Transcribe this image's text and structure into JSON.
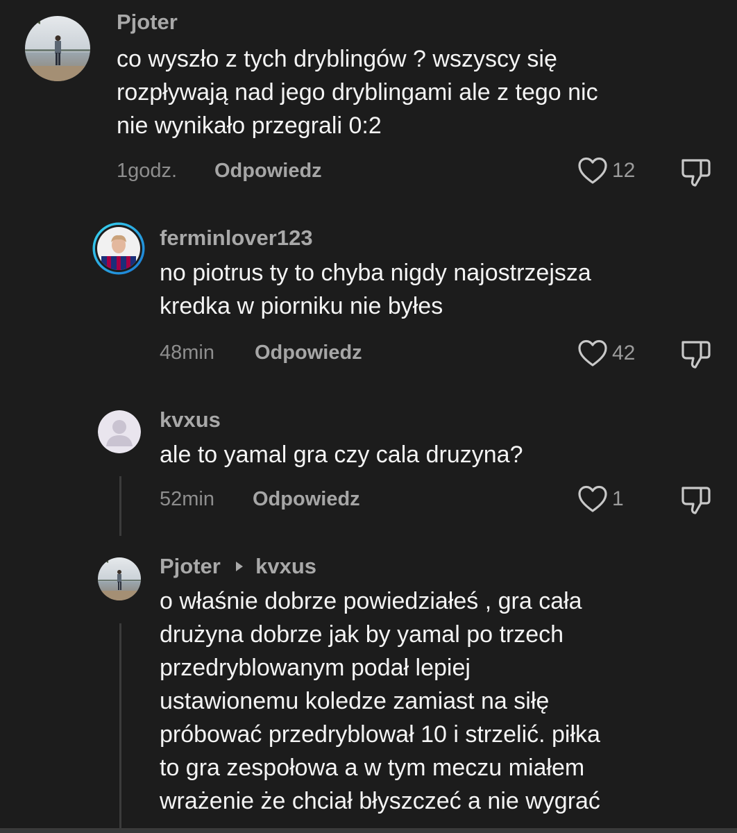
{
  "colors": {
    "background": "#1c1c1c",
    "username": "#a9a9a9",
    "text": "#f4f4f4",
    "meta": "#8e8e8e",
    "story_ring_start": "#3ad8f0",
    "story_ring_end": "#1976d2"
  },
  "icons": {
    "like": "heart-outline-icon",
    "dislike": "thumbs-down-outline-icon",
    "reply_arrow": "caret-right-icon"
  },
  "comments": [
    {
      "username": "Pjoter",
      "lines": [
        "co wyszło z tych dryblingów ? wszyscy się",
        "rozpływają nad jego dryblingami ale z tego nic",
        "nie wynikało przegrali 0:2"
      ],
      "time": "1godz.",
      "reply_label": "Odpowiedz",
      "likes": "12"
    },
    {
      "username": "ferminlover123",
      "lines": [
        "no piotrus ty to chyba nigdy najostrzejsza",
        "kredka w piorniku nie byłes"
      ],
      "time": "48min",
      "reply_label": "Odpowiedz",
      "likes": "42"
    },
    {
      "username": "kvxus",
      "lines": [
        "ale to yamal gra czy cala druzyna?"
      ],
      "time": "52min",
      "reply_label": "Odpowiedz",
      "likes": "1"
    },
    {
      "username": "Pjoter",
      "reply_to": "kvxus",
      "lines": [
        "o właśnie dobrze powiedziałeś , gra cała",
        "drużyna dobrze jak by yamal po trzech",
        "przedryblowanym podał lepiej",
        "ustawionemu koledze zamiast na siłę",
        "próbować przedryblował 10 i strzelić. piłka",
        "to gra zespołowa a w tym meczu miałem",
        "wrażenie że chciał błyszczeć a nie wygrać"
      ]
    }
  ]
}
